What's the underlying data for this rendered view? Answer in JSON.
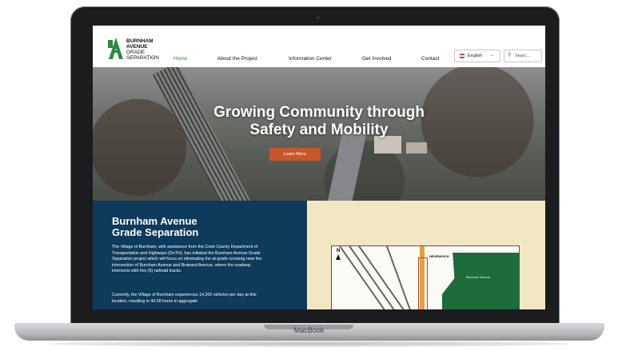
{
  "device": {
    "brand_label": "MacBook"
  },
  "site": {
    "logo": {
      "line1": "BURNHAM",
      "line2": "AVENUE",
      "line3": "GRADE",
      "line4": "SEPARATION"
    },
    "nav": [
      {
        "label": "Home",
        "active": true
      },
      {
        "label": "About the Project"
      },
      {
        "label": "Information Center"
      },
      {
        "label": "Get Involved"
      },
      {
        "label": "Contact"
      }
    ],
    "language": {
      "selected": "English"
    },
    "search": {
      "placeholder": "Searc..."
    }
  },
  "hero": {
    "title_line1": "Growing Community through",
    "title_line2": "Safety and Mobility",
    "button_label": "Learn More"
  },
  "section": {
    "title_line1": "Burnham Avenue",
    "title_line2": "Grade Separation",
    "paragraph1": "The Village of Burnham, with assistance from the Cook County Department of Transportation and Highways (DoTH), has initiated the Burnham Avenue Grade Separation project which will focus on eliminating the at-grade crossing near the intersection of Burnham Avenue and Brainard Avenue, where the roadway intersects with five (5) railroad tracks.",
    "paragraph2": "Currently, the Village of Burnham experiences 14,200 vehicles per day at this location, resulting in 46.58 hours in aggregate"
  },
  "map": {
    "north_label": "N",
    "place_label": "HEGEWISCH",
    "park_label": "Burnham Woods"
  },
  "colors": {
    "brand_green": "#2b8a3e",
    "hero_button": "#c9562b",
    "panel_navy": "#0e3a5c",
    "panel_cream": "#f2e6c4"
  }
}
